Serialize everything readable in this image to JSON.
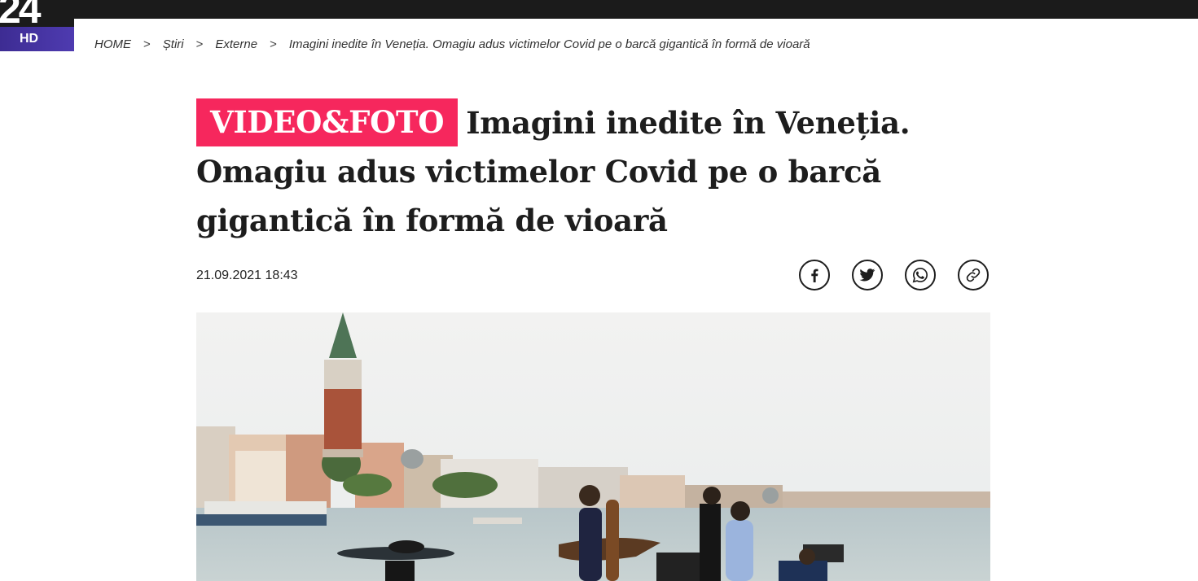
{
  "logo": {
    "number": "24",
    "suffix": "HD"
  },
  "breadcrumb": {
    "home": "HOME",
    "section": "Știri",
    "subsection": "Externe",
    "current": "Imagini inedite în Veneția. Omagiu adus victimelor Covid pe o barcă gigantică în formă de vioară",
    "separator": ">"
  },
  "article": {
    "badge": "VIDEO&FOTO",
    "title": "Imagini inedite în Veneția. Omagiu adus victimelor Covid pe o barcă gigantică în formă de vioară",
    "date": "21.09.2021 18:43"
  },
  "share": {
    "icons": [
      "facebook-icon",
      "twitter-icon",
      "whatsapp-icon",
      "link-icon"
    ]
  },
  "colors": {
    "badge": "#f6275d",
    "topbar": "#1b1b1b",
    "hd": "#3d2c93"
  }
}
